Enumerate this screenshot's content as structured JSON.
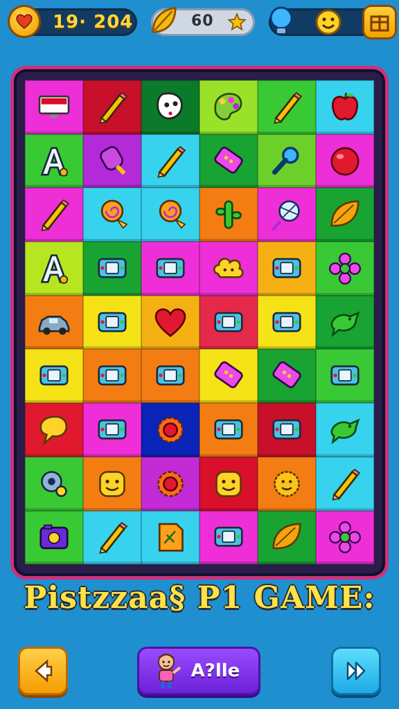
{
  "hud": {
    "score": "19· 204",
    "moves": "60",
    "icons": {
      "score": "heart-coin-icon",
      "moves": "leaf-icon",
      "moves_bonus": "star-icon",
      "hint": "bulb-icon",
      "mood": "smiley-icon",
      "menu": "gift-box-icon"
    }
  },
  "board": {
    "rows": [
      [
        {
          "color": "#ee2fd7",
          "icon": "monitor"
        },
        {
          "color": "#c8102b",
          "icon": "pencil"
        },
        {
          "color": "#0b7a2a",
          "icon": "mask"
        },
        {
          "color": "#9ae22a",
          "icon": "palette"
        },
        {
          "color": "#39c935",
          "icon": "pencil"
        },
        {
          "color": "#37d2ee",
          "icon": "apple"
        }
      ],
      [
        {
          "color": "#39c935",
          "icon": "letter-a"
        },
        {
          "color": "#b42ad8",
          "icon": "popsicle"
        },
        {
          "color": "#37d2ee",
          "icon": "pencil"
        },
        {
          "color": "#18a332",
          "icon": "eraser"
        },
        {
          "color": "#6cd02a",
          "icon": "magnifier"
        },
        {
          "color": "#ee2fd7",
          "icon": "ball"
        }
      ],
      [
        {
          "color": "#ee2fd7",
          "icon": "pencil"
        },
        {
          "color": "#37d2ee",
          "icon": "lollipop"
        },
        {
          "color": "#37d2ee",
          "icon": "lollipop"
        },
        {
          "color": "#f47d13",
          "icon": "cactus"
        },
        {
          "color": "#ee2fd7",
          "icon": "globe"
        },
        {
          "color": "#18a332",
          "icon": "leaf"
        }
      ],
      [
        {
          "color": "#b7e51f",
          "icon": "letter-a"
        },
        {
          "color": "#18a332",
          "icon": "console"
        },
        {
          "color": "#ee2fd7",
          "icon": "console"
        },
        {
          "color": "#ee2fd7",
          "icon": "cloud"
        },
        {
          "color": "#f5b114",
          "icon": "console"
        },
        {
          "color": "#39c935",
          "icon": "flower"
        }
      ],
      [
        {
          "color": "#f47d13",
          "icon": "car"
        },
        {
          "color": "#f5e317",
          "icon": "console"
        },
        {
          "color": "#f5b114",
          "icon": "heart"
        },
        {
          "color": "#e5294a",
          "icon": "console"
        },
        {
          "color": "#f5e317",
          "icon": "console"
        },
        {
          "color": "#18a332",
          "icon": "bird"
        }
      ],
      [
        {
          "color": "#f5e317",
          "icon": "console"
        },
        {
          "color": "#f47d13",
          "icon": "console"
        },
        {
          "color": "#f47d13",
          "icon": "console"
        },
        {
          "color": "#f5e317",
          "icon": "eraser"
        },
        {
          "color": "#18a332",
          "icon": "eraser"
        },
        {
          "color": "#39c935",
          "icon": "console"
        }
      ],
      [
        {
          "color": "#e0192e",
          "icon": "bubble"
        },
        {
          "color": "#ee2fd7",
          "icon": "console"
        },
        {
          "color": "#0a23b8",
          "icon": "gear"
        },
        {
          "color": "#f47d13",
          "icon": "console"
        },
        {
          "color": "#c8102b",
          "icon": "console"
        },
        {
          "color": "#37d2ee",
          "icon": "bird"
        }
      ],
      [
        {
          "color": "#39c935",
          "icon": "tape"
        },
        {
          "color": "#f47d13",
          "icon": "smile-face"
        },
        {
          "color": "#c22bd6",
          "icon": "gear"
        },
        {
          "color": "#d8102b",
          "icon": "smile-face"
        },
        {
          "color": "#f47d13",
          "icon": "sun-face"
        },
        {
          "color": "#37d2ee",
          "icon": "pencil"
        }
      ],
      [
        {
          "color": "#39c935",
          "icon": "camera"
        },
        {
          "color": "#37d2ee",
          "icon": "pencil"
        },
        {
          "color": "#37d2ee",
          "icon": "note"
        },
        {
          "color": "#ee2fd7",
          "icon": "console"
        },
        {
          "color": "#18a332",
          "icon": "leaf"
        },
        {
          "color": "#ee2fd7",
          "icon": "flower"
        }
      ]
    ]
  },
  "title": "Pistzzaa§ P1 GAME:",
  "buttons": {
    "back": "back-arrow-icon",
    "play_label": "A?lle",
    "forward": "forward-arrow-icon"
  }
}
